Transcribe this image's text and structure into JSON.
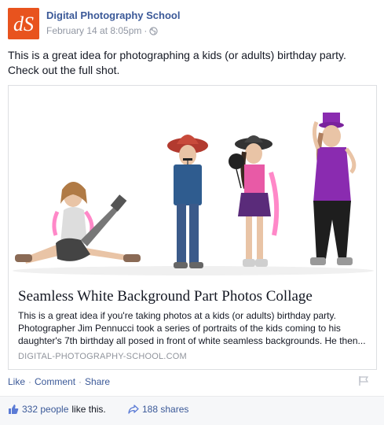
{
  "post": {
    "page_name": "Digital Photography School",
    "avatar_text": "dS",
    "timestamp": "February 14 at 8:05pm",
    "meta_separator": "·",
    "message": "This is a great idea for photographing a kids (or adults) birthday party. Check out the full shot.",
    "link_card": {
      "title": "Seamless White Background Part Photos Collage",
      "description_lines": [
        "This is a great idea if you're taking photos at a kids (or adults) birthday party.",
        "Photographer Jim Pennucci took a series of portraits of the kids coming to his",
        "daughter's 7th birthday all posed in front of white seamless backgrounds. He then..."
      ],
      "domain": "DIGITAL-PHOTOGRAPHY-SCHOOL.COM"
    },
    "actions": {
      "like": "Like",
      "comment": "Comment",
      "share": "Share",
      "separator": "·"
    },
    "footer": {
      "likes_count": "332 people",
      "likes_suffix": "like this.",
      "shares": "188 shares"
    }
  },
  "colors": {
    "link_blue": "#3b5998",
    "meta_gray": "#9197a3",
    "avatar_orange": "#e8531e",
    "footer_bg": "#f6f7f9"
  },
  "icons": [
    "globe-icon",
    "flag-icon",
    "like-thumb-icon",
    "share-arrow-icon"
  ]
}
